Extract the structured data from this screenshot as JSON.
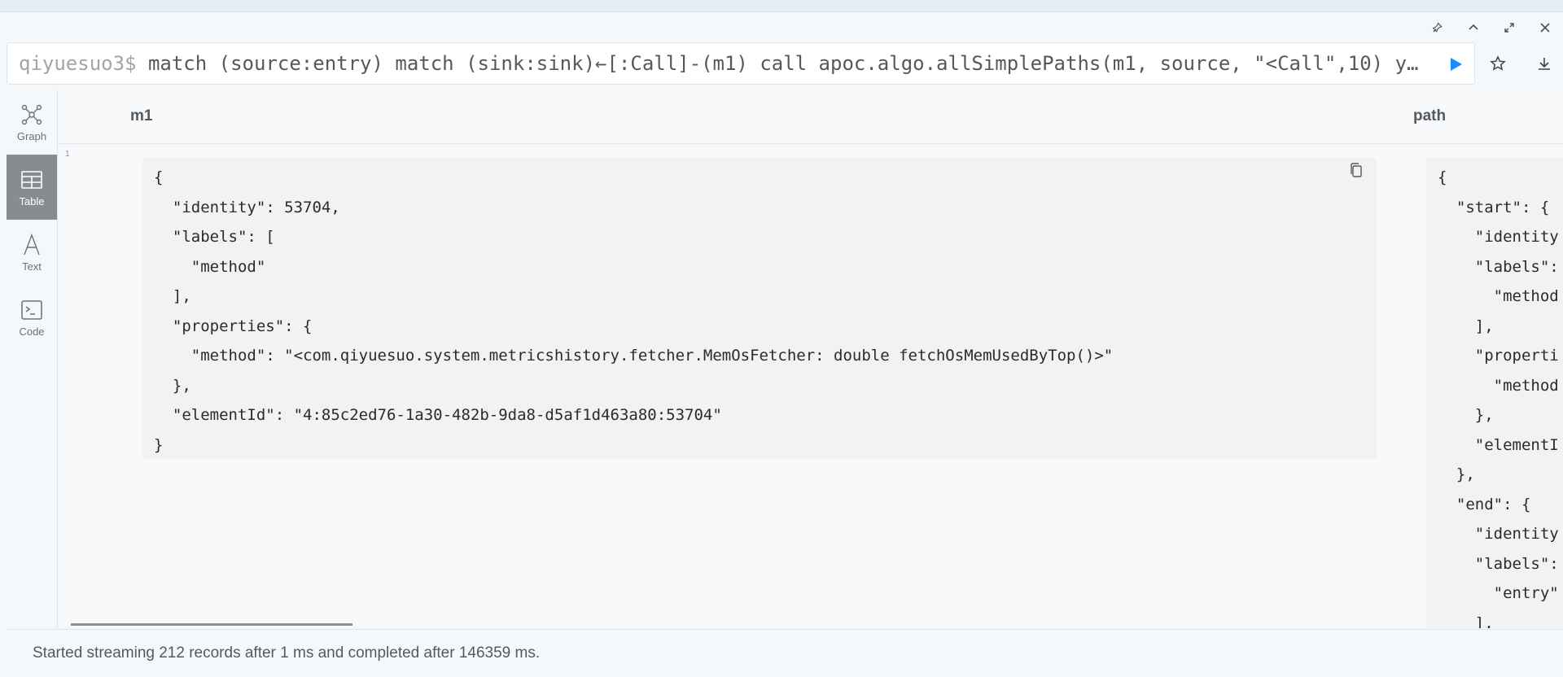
{
  "frame_controls": [
    "pin-icon",
    "collapse-icon",
    "fullscreen-icon",
    "close-icon"
  ],
  "editor": {
    "prompt": "qiyuesuo3$",
    "query": "match (source:entry) match (sink:sink)←[:Call]-(m1) call apoc.algo.allSimplePaths(m1, source, \"<Call\",10) y…"
  },
  "colors": {
    "run": "#1a8cff",
    "active_tab": "#888c90"
  },
  "sidebar": {
    "items": [
      {
        "label": "Graph",
        "icon": "graph-icon",
        "active": false
      },
      {
        "label": "Table",
        "icon": "table-icon",
        "active": true
      },
      {
        "label": "Text",
        "icon": "text-icon",
        "active": false
      },
      {
        "label": "Code",
        "icon": "code-icon",
        "active": false
      }
    ]
  },
  "table": {
    "columns": [
      "m1",
      "path"
    ],
    "row_index": "1",
    "m1_lines": [
      "{",
      "  \"identity\": 53704,",
      "  \"labels\": [",
      "    \"method\"",
      "  ],",
      "  \"properties\": {",
      "    \"method\": \"<com.qiyuesuo.system.metricshistory.fetcher.MemOsFetcher: double fetchOsMemUsedByTop()>\"",
      "  },",
      "  \"elementId\": \"4:85c2ed76-1a30-482b-9da8-d5af1d463a80:53704\"",
      "}"
    ],
    "path_lines": [
      "{",
      "  \"start\": {",
      "    \"identity",
      "    \"labels\":",
      "      \"method",
      "    ],",
      "    \"properti",
      "      \"method",
      "    },",
      "    \"elementI",
      "  },",
      "  \"end\": {",
      "    \"identity",
      "    \"labels\":",
      "      \"entry\"",
      "    ],"
    ]
  },
  "status": "Started streaming 212 records after 1 ms and completed after 146359 ms."
}
